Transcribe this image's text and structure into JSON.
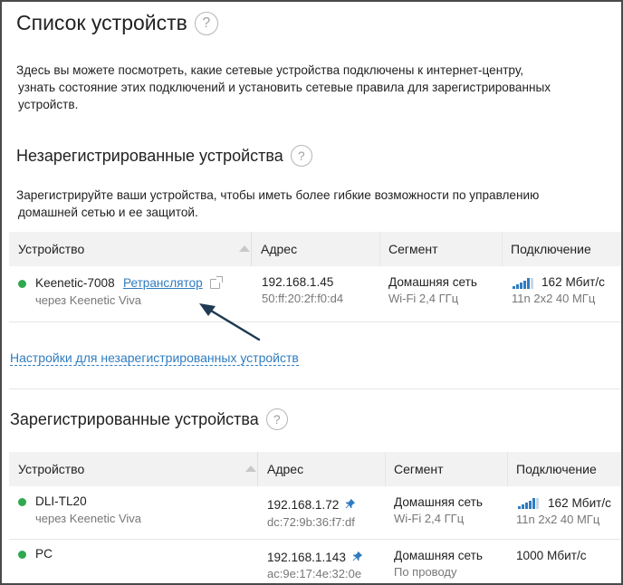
{
  "page": {
    "title": "Список устройств",
    "help_glyph": "?",
    "intro": [
      "Здесь вы можете посмотреть, какие сетевые устройства подключены к интернет-центру,",
      "узнать состояние этих подключений и установить сетевые правила для зарегистрированных",
      "устройств."
    ]
  },
  "unregistered": {
    "title": "Незарегистрированные устройства",
    "description": [
      "Зарегистрируйте ваши устройства, чтобы иметь более гибкие возможности по управлению",
      "домашней сетью и ее защитой."
    ],
    "columns": {
      "device": "Устройство",
      "address": "Адрес",
      "segment": "Сегмент",
      "connection": "Подключение"
    },
    "rows": [
      {
        "name": "Keenetic-7008",
        "role_link": "Ретранслятор",
        "via": "через Keenetic Viva",
        "ip": "192.168.1.45",
        "mac": "50:ff:20:2f:f0:d4",
        "segment": "Домашняя сеть",
        "segment_sub": "Wi-Fi 2,4 ГГц",
        "speed": "162 Мбит/с",
        "mode": "11n 2x2 40 МГц",
        "status_color": "#2fa84f"
      }
    ],
    "settings_link": "Настройки для незарегистрированных устройств"
  },
  "registered": {
    "title": "Зарегистрированные устройства",
    "columns": {
      "device": "Устройство",
      "address": "Адрес",
      "segment": "Сегмент",
      "connection": "Подключение"
    },
    "rows": [
      {
        "name": "DLI-TL20",
        "via": "через Keenetic Viva",
        "ip": "192.168.1.72",
        "mac": "dc:72:9b:36:f7:df",
        "segment": "Домашняя сеть",
        "segment_sub": "Wi-Fi 2,4 ГГц",
        "speed": "162 Мбит/с",
        "mode": "11n 2x2 40 МГц",
        "status_color": "#2fa84f"
      },
      {
        "name": "PC",
        "ip": "192.168.1.143",
        "mac": "ac:9e:17:4e:32:0e",
        "segment": "Домашняя сеть",
        "segment_sub": "По проводу",
        "speed": "1000 Мбит/с",
        "status_color": "#2fa84f"
      }
    ]
  },
  "colors": {
    "link": "#2f7cc0",
    "status_online": "#2fa84f",
    "header_bg": "#f2f2f2",
    "arrow": "#1f3a52"
  },
  "icons": [
    "help-icon",
    "sort-up-icon",
    "external-link-icon",
    "wifi-signal-icon",
    "pin-icon",
    "annotation-arrow"
  ]
}
